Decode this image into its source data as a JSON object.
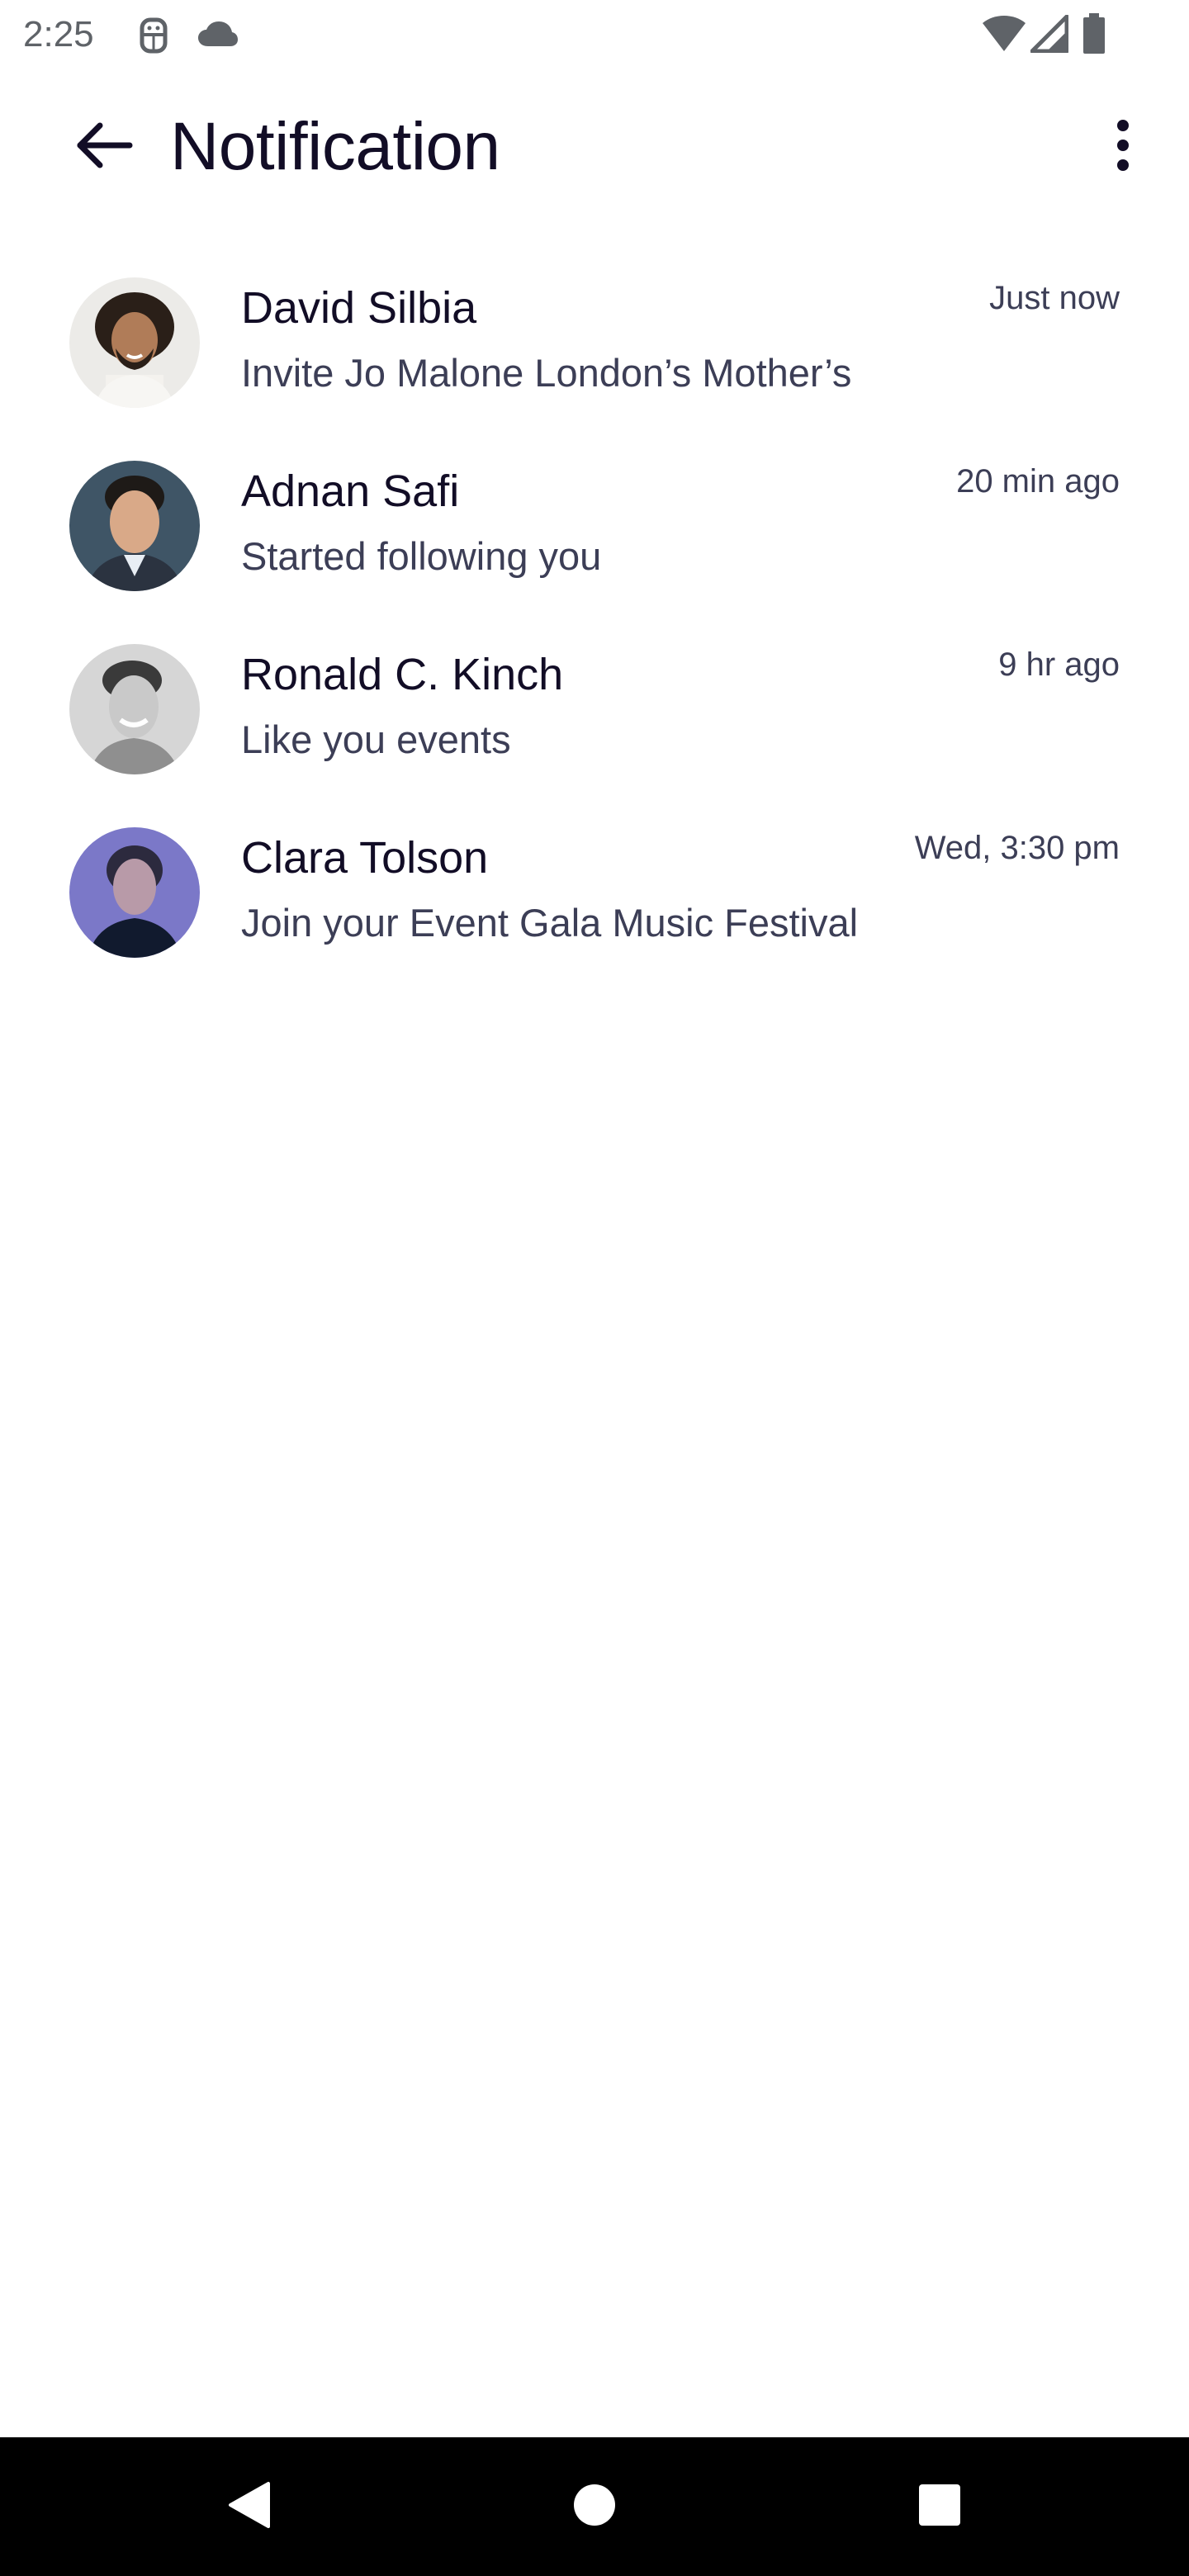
{
  "status_bar": {
    "time": "2:25",
    "icons": [
      "android-debug-icon",
      "cloud-icon",
      "wifi-icon",
      "cell-signal-icon",
      "battery-icon"
    ]
  },
  "app_bar": {
    "title": "Notification",
    "back_icon": "arrow-back-icon",
    "more_icon": "more-vertical-icon"
  },
  "notifications": [
    {
      "name": "David Silbia",
      "message": "Invite Jo Malone London’s Mother’s",
      "time": "Just now"
    },
    {
      "name": "Adnan Safi",
      "message": "Started following you",
      "time": "20 min ago"
    },
    {
      "name": "Ronald C. Kinch",
      "message": "Like you events",
      "time": "9 hr ago"
    },
    {
      "name": "Clara Tolson",
      "message": "Join your Event Gala Music Festival",
      "time": "Wed, 3:30 pm"
    }
  ],
  "nav_bar": {
    "icons": [
      "nav-back-icon",
      "nav-home-icon",
      "nav-recents-icon"
    ]
  },
  "colors": {
    "title": "#120d26",
    "body_text": "#3c3e56",
    "status_text": "#5f6368",
    "nav_bar_bg": "#000000",
    "background": "#ffffff"
  }
}
